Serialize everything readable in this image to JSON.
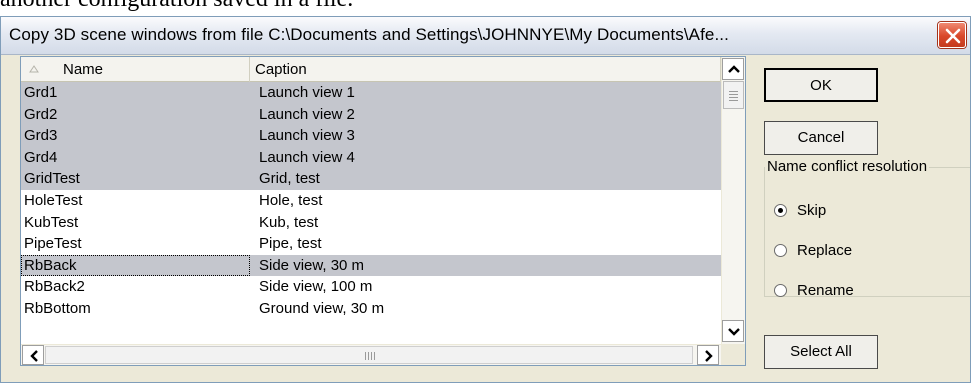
{
  "background": {
    "text": "another configuration saved in a file."
  },
  "dialog": {
    "title": "Copy 3D scene windows from file C:\\Documents and Settings\\JOHNNYE\\My Documents\\Afe...",
    "close_label": "✕"
  },
  "list": {
    "columns": [
      "Name",
      "Caption"
    ],
    "rows": [
      {
        "name": "Grd1",
        "caption": "Launch view 1",
        "selected": true
      },
      {
        "name": "Grd2",
        "caption": "Launch view 2",
        "selected": true
      },
      {
        "name": "Grd3",
        "caption": "Launch view 3",
        "selected": true
      },
      {
        "name": "Grd4",
        "caption": "Launch view 4",
        "selected": true
      },
      {
        "name": "GridTest",
        "caption": "Grid, test",
        "selected": true
      },
      {
        "name": "HoleTest",
        "caption": "Hole, test",
        "selected": false
      },
      {
        "name": "KubTest",
        "caption": "Kub, test",
        "selected": false
      },
      {
        "name": "PipeTest",
        "caption": "Pipe, test",
        "selected": false
      },
      {
        "name": "RbBack",
        "caption": "Side view, 30 m",
        "selected": true
      },
      {
        "name": "RbBack2",
        "caption": "Side view, 100 m",
        "selected": false
      },
      {
        "name": "RbBottom",
        "caption": "Ground view, 30 m",
        "selected": false
      }
    ]
  },
  "buttons": {
    "ok": "OK",
    "cancel": "Cancel",
    "select_all": "Select All"
  },
  "conflict": {
    "group_label": "Name conflict resolution",
    "options": [
      "Skip",
      "Replace",
      "Rename"
    ],
    "selected": "Skip"
  }
}
